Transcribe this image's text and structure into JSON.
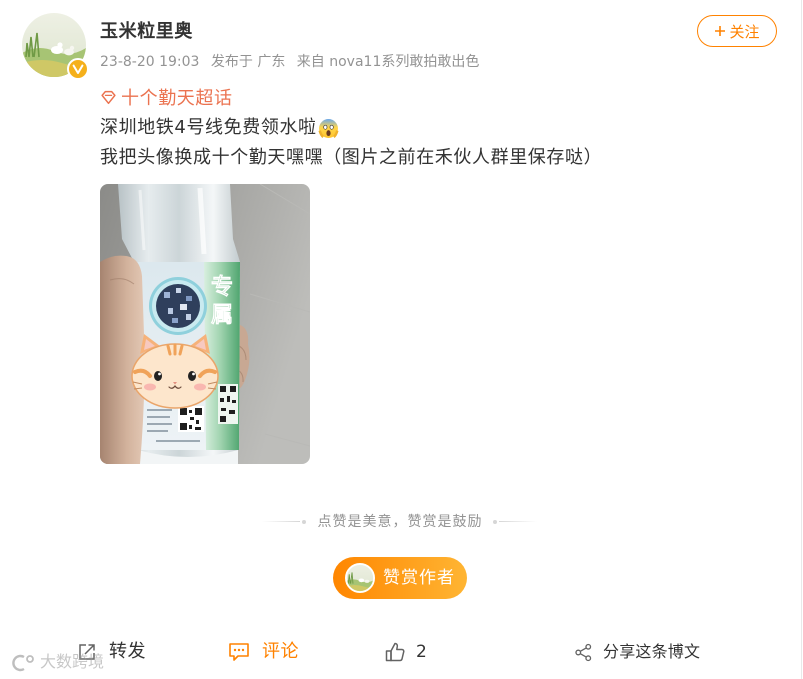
{
  "post": {
    "author": {
      "name": "玉米粒里奥",
      "avatar_icon": "avatar-image",
      "verified_icon": "verified-badge-icon"
    },
    "follow_button": {
      "icon": "plus-icon",
      "label": "关注"
    },
    "meta": {
      "time": "23-8-20 19:03",
      "location": "发布于 广东",
      "source": "来自 nova11系列敢拍敢出色"
    },
    "topic": {
      "icon": "supertopic-icon",
      "label": "十个勤天超话"
    },
    "text": {
      "line1": "深圳地铁4号线免费领水啦",
      "line1_emoji": "scream-emoji-icon",
      "line2": "我把头像换成十个勤天嘿嘿（图片之前在禾伙人群里保存哒）"
    },
    "image": {
      "bottle_text": [
        "专",
        "属"
      ]
    }
  },
  "reward": {
    "divider_text": "点赞是美意，赞赏是鼓励",
    "button_label": "赞赏作者"
  },
  "actions": {
    "repost": {
      "icon": "repost-icon",
      "label": "转发"
    },
    "comment": {
      "icon": "comment-icon",
      "label": "评论",
      "selected": true
    },
    "like": {
      "icon": "thumbs-up-icon",
      "count": 2
    },
    "share": {
      "icon": "share-icon",
      "label": "分享这条博文"
    }
  },
  "watermark": {
    "text": "大数跨境"
  },
  "colors": {
    "accent": "#ff8200",
    "topic": "#eb7350",
    "text": "#333333",
    "meta": "#939393",
    "icon": "#636363"
  }
}
